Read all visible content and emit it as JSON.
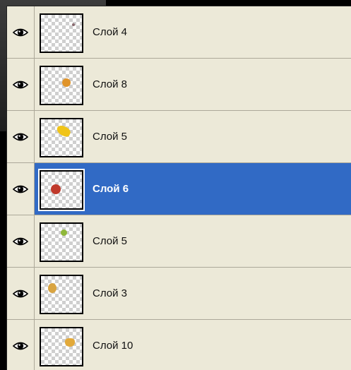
{
  "layers_panel": {
    "layers": [
      {
        "name": "Слой 4",
        "visible": true,
        "selected": false,
        "thumb_color": "#8a6a70"
      },
      {
        "name": "Слой 8",
        "visible": true,
        "selected": false,
        "thumb_color": "#e0942a"
      },
      {
        "name": "Слой 5",
        "visible": true,
        "selected": false,
        "thumb_color": "#f0c419"
      },
      {
        "name": "Слой 6",
        "visible": true,
        "selected": true,
        "thumb_color": "#c0392b"
      },
      {
        "name": "Слой 5",
        "visible": true,
        "selected": false,
        "thumb_color": "#8fb83a"
      },
      {
        "name": "Слой 3",
        "visible": true,
        "selected": false,
        "thumb_color": "#d9a441"
      },
      {
        "name": "Слой 10",
        "visible": true,
        "selected": false,
        "thumb_color": "#e2a93a"
      }
    ],
    "eye_icon": "eye-icon",
    "selection_color": "#316ac5",
    "panel_bg": "#ece9d8"
  }
}
